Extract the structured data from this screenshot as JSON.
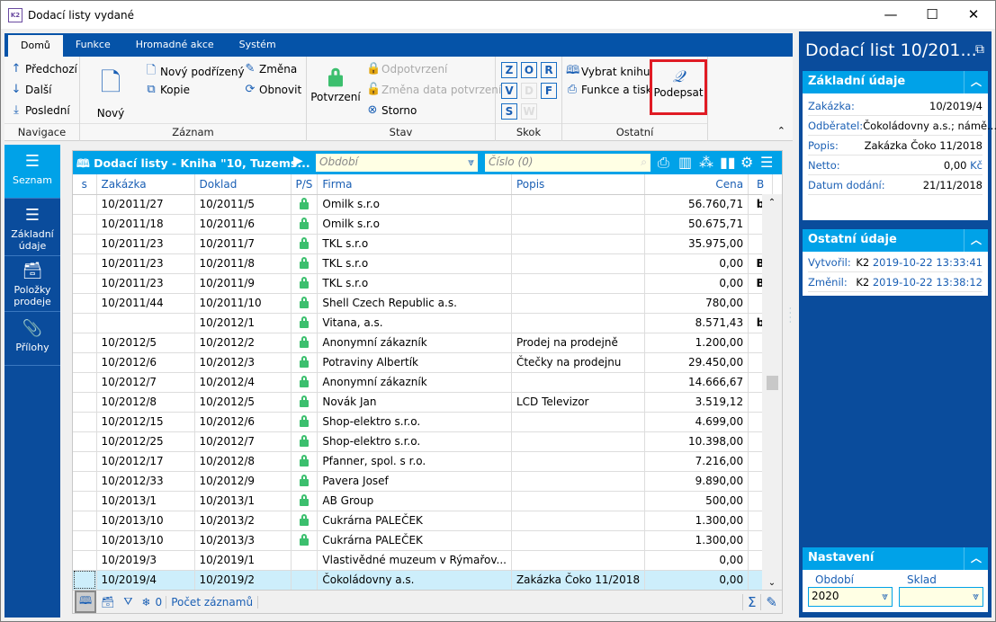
{
  "window": {
    "title": "Dodací listy vydané",
    "logo": "K2"
  },
  "ribbon": {
    "tabs": [
      "Domů",
      "Funkce",
      "Hromadné akce",
      "Systém"
    ],
    "groups": {
      "navigace": "Navigace",
      "zaznam": "Záznam",
      "stav": "Stav",
      "skok": "Skok",
      "ostatni": "Ostatní"
    },
    "predchozi": "Předchozí",
    "dalsi": "Další",
    "posledni": "Poslední",
    "novy": "Nový",
    "novy_podrizeny": "Nový podřízený",
    "kopie": "Kopie",
    "zmena": "Změna",
    "obnovit": "Obnovit",
    "potvrzeni": "Potvrzení",
    "odpotvrzeni": "Odpotvrzení",
    "zmena_data": "Změna data potvrzení",
    "storno": "Storno",
    "skok_keys": [
      "Z",
      "O",
      "R",
      "V",
      "D",
      "F",
      "S",
      "W"
    ],
    "vybrat_knihu": "Vybrat knihu",
    "funkce_tisk": "Funkce a tisk",
    "podepsat": "Podepsat"
  },
  "nav": [
    "Seznam",
    "Základní údaje",
    "Položky prodeje",
    "Přílohy"
  ],
  "grid": {
    "title": "Dodací listy - Kniha \"10, Tuzems...",
    "obdobi_placeholder": "Období",
    "cislo_placeholder": "Číslo (0)",
    "columns": [
      "s",
      "Zakázka",
      "Doklad",
      "P/S",
      "Firma",
      "Popis",
      "Cena",
      "B"
    ],
    "rows": [
      {
        "zakazka": "10/2011/27",
        "doklad": "10/2011/5",
        "lock": true,
        "firma": "Omilk s.r.o",
        "popis": "",
        "cena": "56.760,71",
        "b": "b"
      },
      {
        "zakazka": "10/2011/18",
        "doklad": "10/2011/6",
        "lock": true,
        "firma": "Omilk s.r.o",
        "popis": "",
        "cena": "50.675,71",
        "b": ""
      },
      {
        "zakazka": "10/2011/23",
        "doklad": "10/2011/7",
        "lock": true,
        "firma": "TKL s.r.o",
        "popis": "",
        "cena": "35.975,00",
        "b": ""
      },
      {
        "zakazka": "10/2011/23",
        "doklad": "10/2011/8",
        "lock": true,
        "firma": "TKL s.r.o",
        "popis": "",
        "cena": "0,00",
        "b": "B"
      },
      {
        "zakazka": "10/2011/23",
        "doklad": "10/2011/9",
        "lock": true,
        "firma": "TKL s.r.o",
        "popis": "",
        "cena": "0,00",
        "b": "B"
      },
      {
        "zakazka": "10/2011/44",
        "doklad": "10/2011/10",
        "lock": true,
        "firma": "Shell Czech Republic a.s.",
        "popis": "",
        "cena": "780,00",
        "b": ""
      },
      {
        "zakazka": "",
        "doklad": "10/2012/1",
        "lock": true,
        "firma": "Vitana, a.s.",
        "popis": "",
        "cena": "8.571,43",
        "b": "b"
      },
      {
        "zakazka": "10/2012/5",
        "doklad": "10/2012/2",
        "lock": true,
        "firma": "Anonymní zákazník",
        "popis": "Prodej na prodejně",
        "cena": "1.200,00",
        "b": ""
      },
      {
        "zakazka": "10/2012/6",
        "doklad": "10/2012/3",
        "lock": true,
        "firma": "Potraviny Albertík",
        "popis": "Čtečky na prodejnu",
        "cena": "29.450,00",
        "b": ""
      },
      {
        "zakazka": "10/2012/7",
        "doklad": "10/2012/4",
        "lock": true,
        "firma": "Anonymní zákazník",
        "popis": "",
        "cena": "14.666,67",
        "b": ""
      },
      {
        "zakazka": "10/2012/8",
        "doklad": "10/2012/5",
        "lock": true,
        "firma": "Novák Jan",
        "popis": "LCD Televizor",
        "cena": "3.519,12",
        "b": ""
      },
      {
        "zakazka": "10/2012/15",
        "doklad": "10/2012/6",
        "lock": true,
        "firma": "Shop-elektro s.r.o.",
        "popis": "",
        "cena": "4.699,00",
        "b": ""
      },
      {
        "zakazka": "10/2012/25",
        "doklad": "10/2012/7",
        "lock": true,
        "firma": "Shop-elektro s.r.o.",
        "popis": "",
        "cena": "10.398,00",
        "b": ""
      },
      {
        "zakazka": "10/2012/17",
        "doklad": "10/2012/8",
        "lock": true,
        "firma": "Pfanner, spol. s r.o.",
        "popis": "",
        "cena": "7.216,00",
        "b": ""
      },
      {
        "zakazka": "10/2012/33",
        "doklad": "10/2012/9",
        "lock": true,
        "firma": "Pavera Josef",
        "popis": "",
        "cena": "9.890,00",
        "b": ""
      },
      {
        "zakazka": "10/2013/1",
        "doklad": "10/2013/1",
        "lock": true,
        "firma": "AB Group",
        "popis": "",
        "cena": "500,00",
        "b": ""
      },
      {
        "zakazka": "10/2013/10",
        "doklad": "10/2013/2",
        "lock": true,
        "firma": "Cukrárna PALEČEK",
        "popis": "",
        "cena": "1.300,00",
        "b": ""
      },
      {
        "zakazka": "10/2013/10",
        "doklad": "10/2013/3",
        "lock": true,
        "firma": "Cukrárna PALEČEK",
        "popis": "",
        "cena": "1.300,00",
        "b": ""
      },
      {
        "zakazka": "10/2019/3",
        "doklad": "10/2019/1",
        "lock": false,
        "firma": "Vlastivědné muzeum v Rýmařov...",
        "popis": "",
        "cena": "0,00",
        "b": ""
      },
      {
        "zakazka": "10/2019/4",
        "doklad": "10/2019/2",
        "lock": false,
        "firma": "Čokoládovny a.s.",
        "popis": "Zakázka Čoko 11/2018",
        "cena": "0,00",
        "b": "",
        "selected": true
      }
    ],
    "footer": {
      "filter_count": "0",
      "record_count": "Počet záznamů"
    }
  },
  "detail": {
    "title": "Dodací list 10/201...",
    "zakladni": {
      "header": "Základní údaje",
      "fields": [
        {
          "label": "Zakázka:",
          "value": "10/2019/4"
        },
        {
          "label": "Odběratel:",
          "value": "Čokoládovny a.s.; námě..."
        },
        {
          "label": "Popis:",
          "value": "Zakázka Čoko 11/2018"
        },
        {
          "label": "Netto:",
          "value": "0,00",
          "unit": "Kč"
        },
        {
          "label": "Datum dodání:",
          "value": "21/11/2018"
        }
      ]
    },
    "ostatni": {
      "header": "Ostatní údaje",
      "fields": [
        {
          "label": "Vytvořil:",
          "user": "K2",
          "value": "2019-10-22 13:33:41"
        },
        {
          "label": "Změnil:",
          "user": "K2",
          "value": "2019-10-22 13:38:12"
        }
      ]
    },
    "nastaveni": {
      "header": "Nastavení",
      "obdobi_label": "Období",
      "obdobi_value": "2020",
      "sklad_label": "Sklad",
      "sklad_value": ""
    }
  },
  "colors": {
    "ribbon_blue": "#0553a8",
    "accent_cyan": "#00a2e8",
    "lock_green": "#3cbf6e",
    "highlight_red": "#e01b24",
    "selected_row": "#cdeefb"
  }
}
